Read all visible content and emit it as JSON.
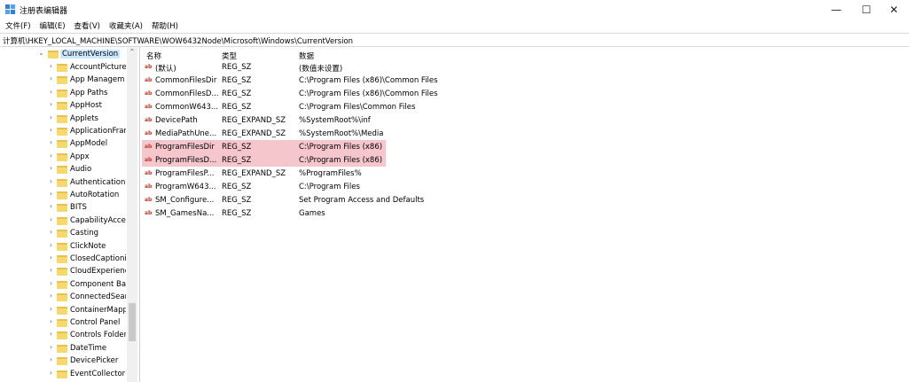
{
  "window": {
    "title": "注册表编辑器",
    "min_glyph": "—",
    "max_glyph": "☐",
    "close_glyph": "✕"
  },
  "menu": [
    "文件(F)",
    "编辑(E)",
    "查看(V)",
    "收藏夹(A)",
    "帮助(H)"
  ],
  "address": "计算机\\HKEY_LOCAL_MACHINE\\SOFTWARE\\WOW6432Node\\Microsoft\\Windows\\CurrentVersion",
  "tree": {
    "selected": "CurrentVersion",
    "items": [
      "AccountPicture",
      "App Managem",
      "App Paths",
      "AppHost",
      "Applets",
      "ApplicationFrar",
      "AppModel",
      "Appx",
      "Audio",
      "Authentication",
      "AutoRotation",
      "BITS",
      "CapabilityAcces",
      "Casting",
      "ClickNote",
      "ClosedCaptioni",
      "CloudExperienc",
      "Component Ba",
      "ConnectedSear",
      "ContainerMapp",
      "Control Panel",
      "Controls Folder",
      "DateTime",
      "DevicePicker",
      "EventCollector"
    ]
  },
  "columns": {
    "name": "名称",
    "type": "类型",
    "data": "数据"
  },
  "values": [
    {
      "name": "(默认)",
      "type": "REG_SZ",
      "data": "(数值未设置)",
      "highlight": false
    },
    {
      "name": "CommonFilesDir",
      "type": "REG_SZ",
      "data": "C:\\Program Files (x86)\\Common Files",
      "highlight": false
    },
    {
      "name": "CommonFilesD...",
      "type": "REG_SZ",
      "data": "C:\\Program Files (x86)\\Common Files",
      "highlight": false
    },
    {
      "name": "CommonW643...",
      "type": "REG_SZ",
      "data": "C:\\Program Files\\Common Files",
      "highlight": false
    },
    {
      "name": "DevicePath",
      "type": "REG_EXPAND_SZ",
      "data": "%SystemRoot%\\inf",
      "highlight": false
    },
    {
      "name": "MediaPathUne...",
      "type": "REG_EXPAND_SZ",
      "data": "%SystemRoot%\\Media",
      "highlight": false
    },
    {
      "name": "ProgramFilesDir",
      "type": "REG_SZ",
      "data": "C:\\Program Files (x86)",
      "highlight": true
    },
    {
      "name": "ProgramFilesD...",
      "type": "REG_SZ",
      "data": "C:\\Program Files (x86)",
      "highlight": true
    },
    {
      "name": "ProgramFilesP...",
      "type": "REG_EXPAND_SZ",
      "data": "%ProgramFiles%",
      "highlight": false
    },
    {
      "name": "ProgramW643...",
      "type": "REG_SZ",
      "data": "C:\\Program Files",
      "highlight": false
    },
    {
      "name": "SM_Configure...",
      "type": "REG_SZ",
      "data": "Set Program Access and Defaults",
      "highlight": false
    },
    {
      "name": "SM_GamesNa...",
      "type": "REG_SZ",
      "data": "Games",
      "highlight": false
    }
  ],
  "colors": {
    "highlight": "#f5c6cc",
    "selected_tree": "#cce8ff",
    "folder": "#f7d96b"
  },
  "icons": {
    "value": "ab-string-icon",
    "folder": "folder-icon",
    "expand": "chevron-right-icon"
  }
}
